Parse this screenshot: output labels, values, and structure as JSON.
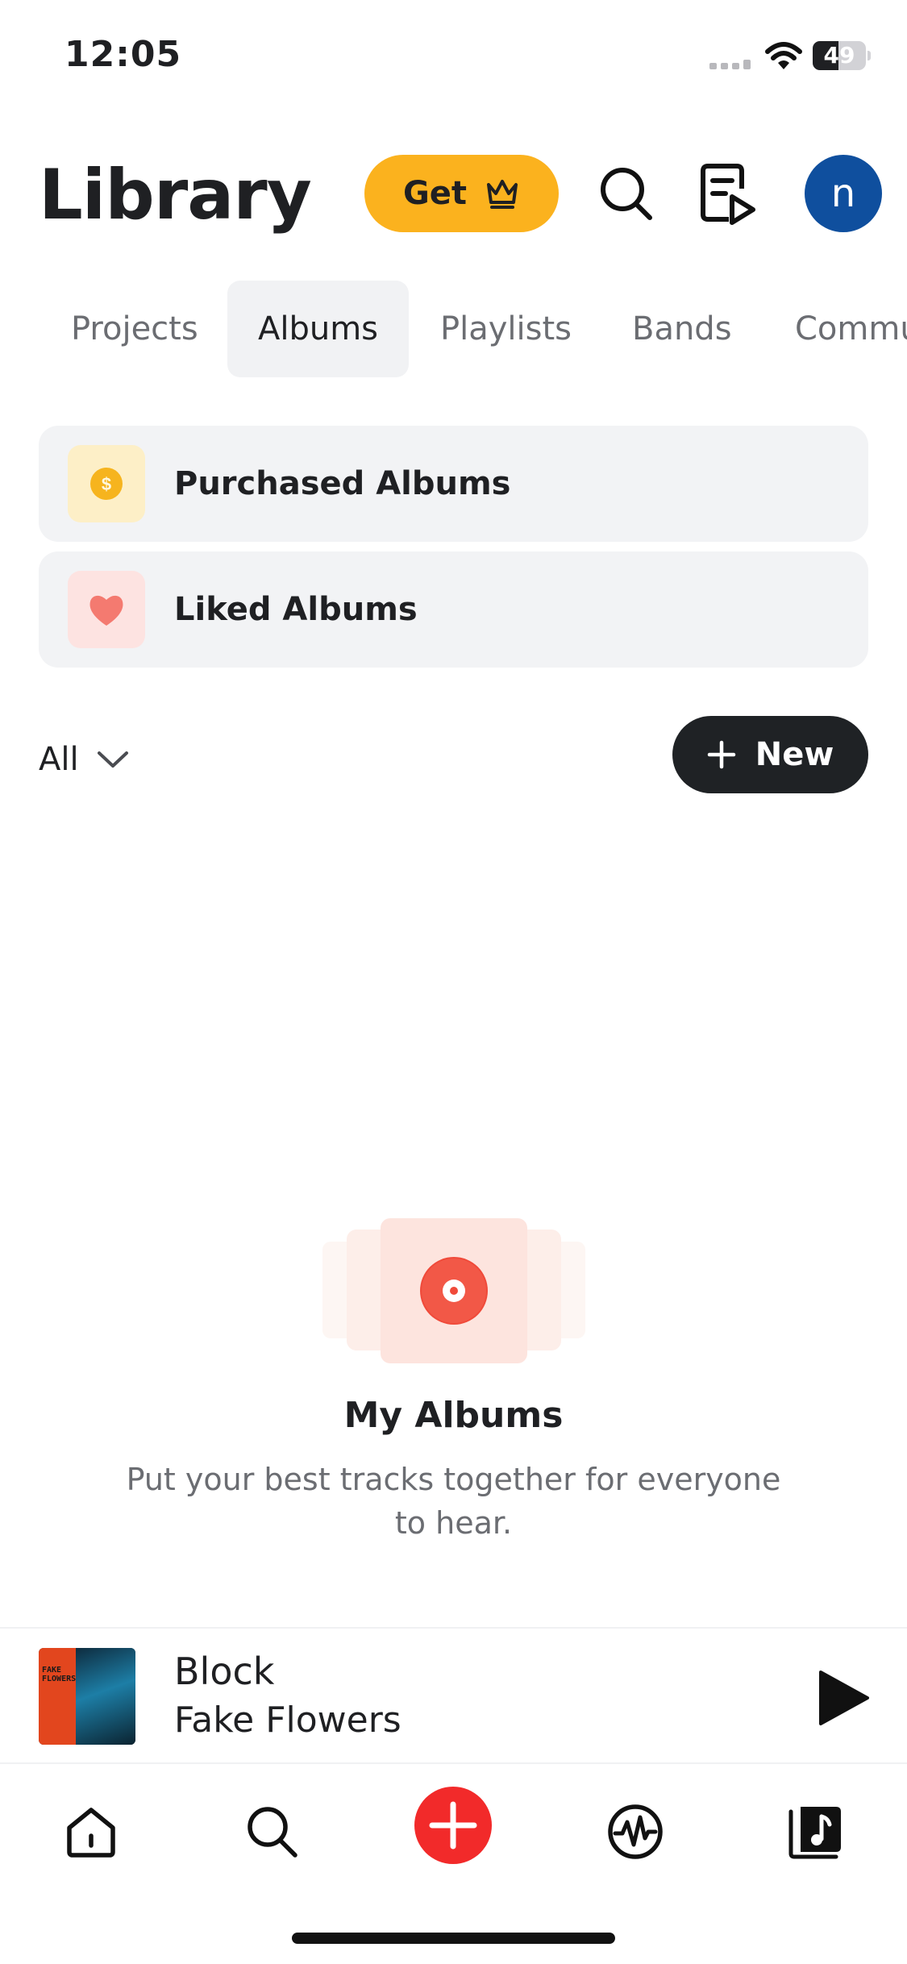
{
  "status_bar": {
    "time": "12:05",
    "battery": "49",
    "battery_level": 0.49
  },
  "header": {
    "title": "Library",
    "premium_label": "Get",
    "icons": [
      "crown-icon",
      "search-icon",
      "queue-icon"
    ],
    "avatar_letter": "n"
  },
  "tabs": [
    {
      "label": "Projects",
      "active": false
    },
    {
      "label": "Albums",
      "active": true
    },
    {
      "label": "Playlists",
      "active": false
    },
    {
      "label": "Bands",
      "active": false
    },
    {
      "label": "Commu",
      "active": false
    }
  ],
  "quick_rows": [
    {
      "label": "Purchased Albums",
      "icon": "coin-icon",
      "icon_bg": "#fdefc7",
      "icon_color": "#f6b41e"
    },
    {
      "label": "Liked Albums",
      "icon": "heart-icon",
      "icon_bg": "#fde3e1",
      "icon_color": "#f47a70"
    }
  ],
  "filter": {
    "label": "All"
  },
  "new_button": {
    "label": "New"
  },
  "empty_state": {
    "title": "My Albums",
    "description": "Put your best tracks together for everyone to hear."
  },
  "mini_player": {
    "title": "Block",
    "artist": "Fake Flowers",
    "album_art_text": "FAKE FLOWERS"
  },
  "nav": [
    {
      "icon": "home-icon"
    },
    {
      "icon": "search-icon"
    },
    {
      "icon": "add-icon"
    },
    {
      "icon": "waveform-icon"
    },
    {
      "icon": "library-icon"
    }
  ],
  "colors": {
    "accent_yellow": "#fbb21e",
    "accent_red": "#f22a2a",
    "avatar_blue": "#0f4f9e",
    "dark": "#1f2225"
  }
}
